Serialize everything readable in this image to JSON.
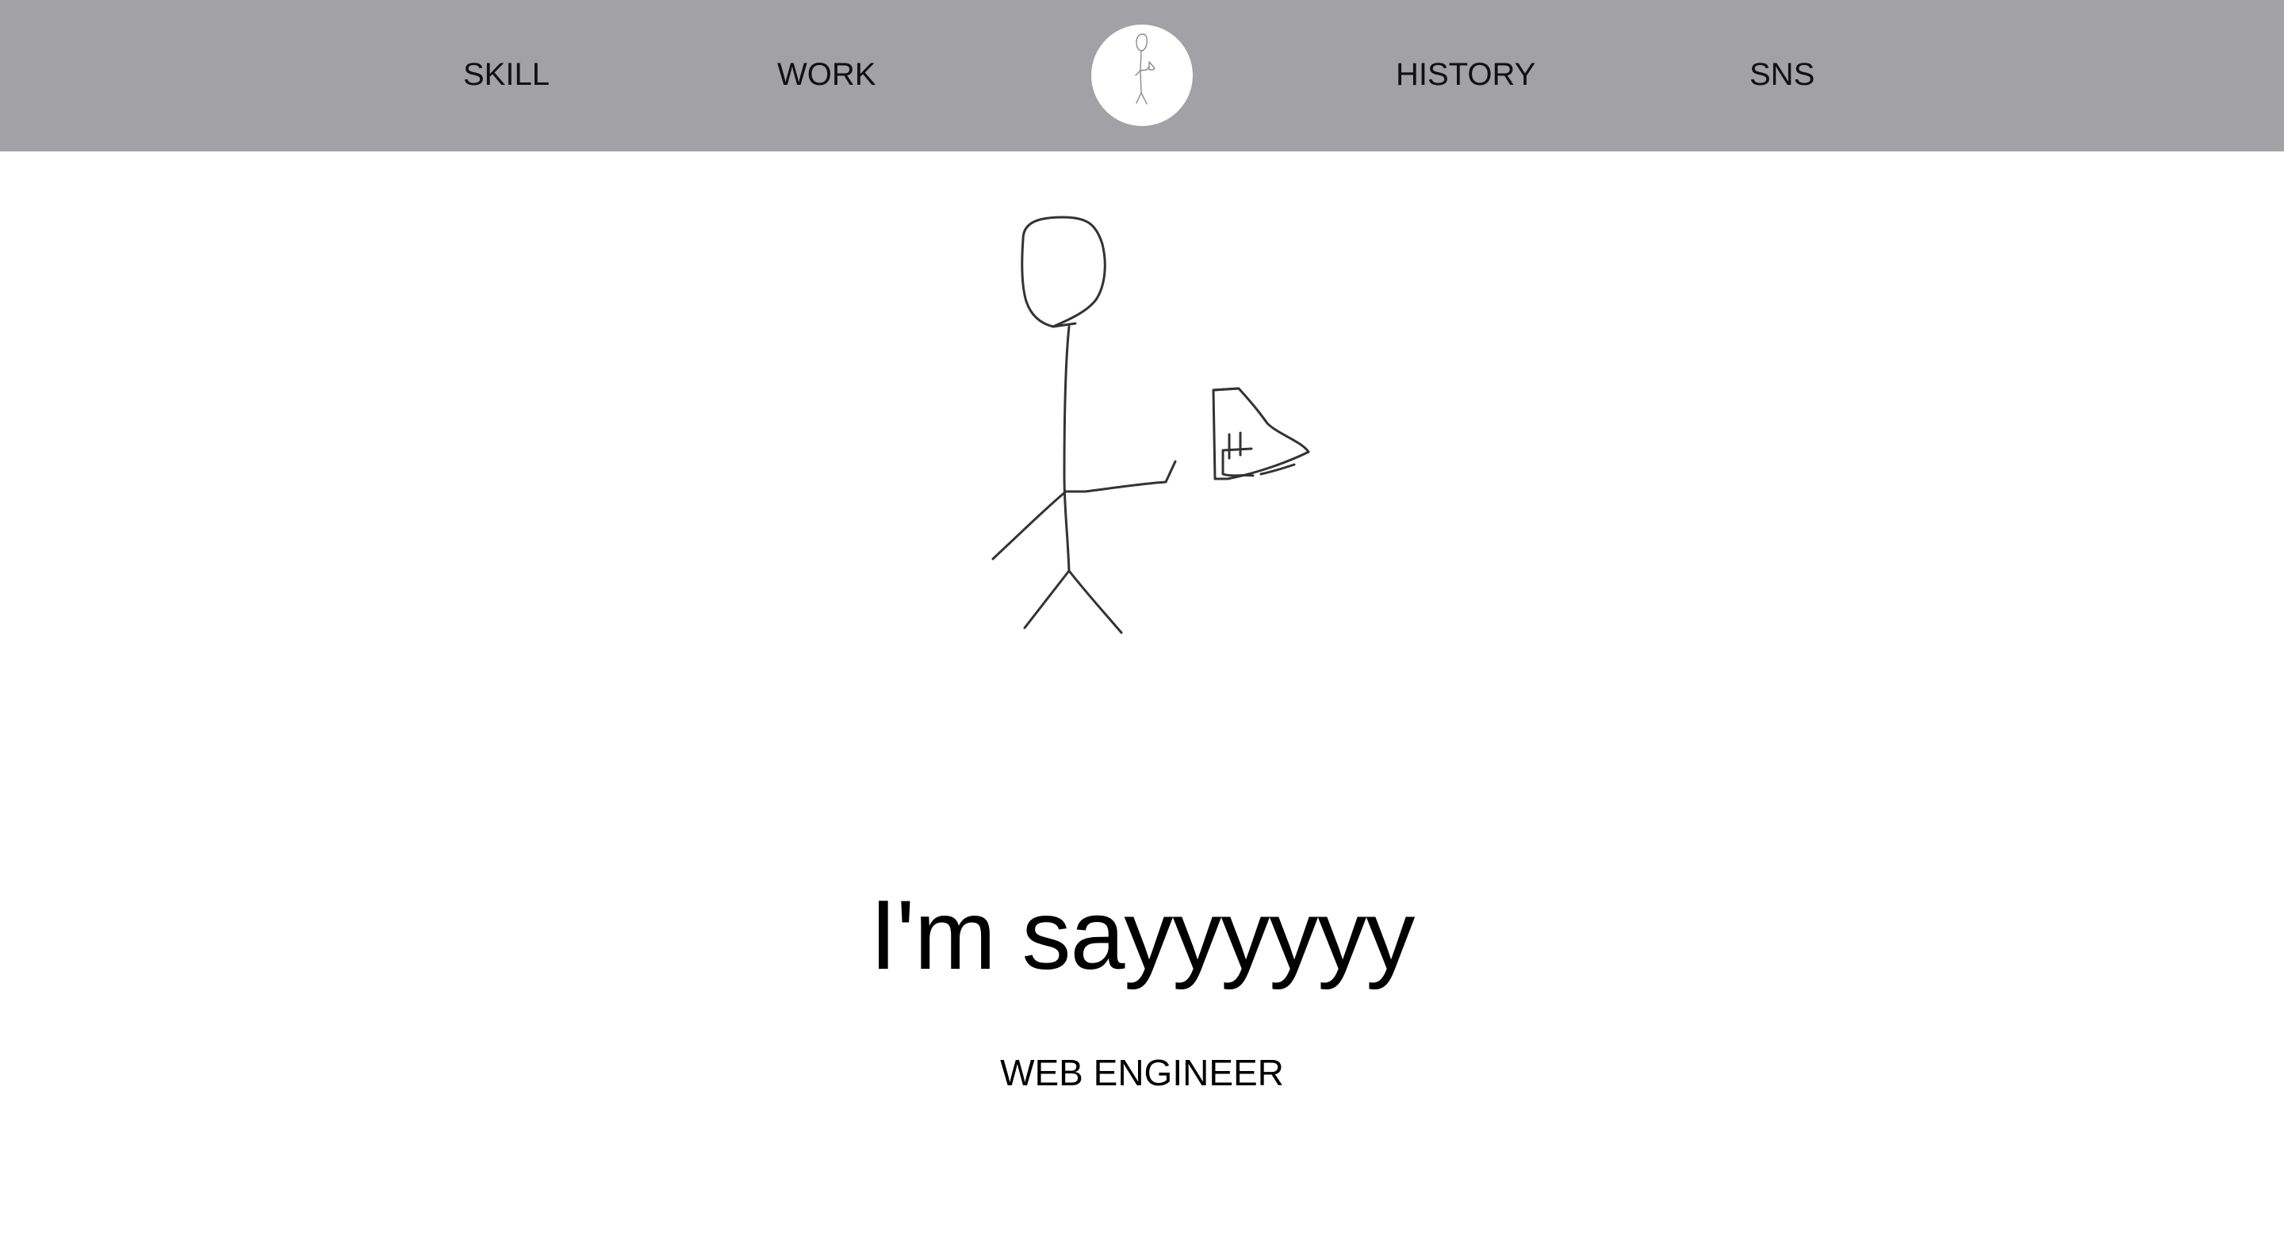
{
  "header": {
    "background_color": "#a1a1a6",
    "nav": {
      "skill": "SKILL",
      "work": "WORK",
      "history": "HISTORY",
      "sns": "SNS"
    },
    "logo_icon": "stick-figure-logo-icon"
  },
  "hero": {
    "illustration_icon": "stick-figure-holding-sign-icon",
    "title": "I'm sayyyyyy",
    "subtitle": "WEB ENGINEER"
  }
}
